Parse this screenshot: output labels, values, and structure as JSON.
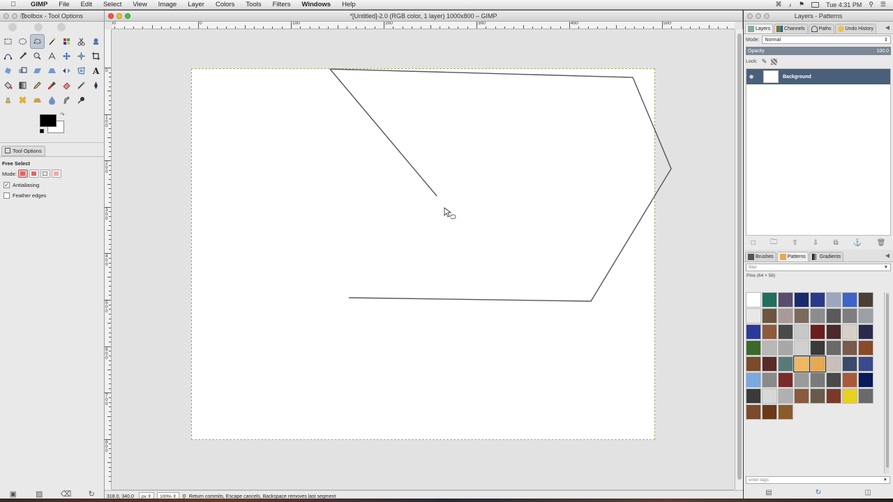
{
  "menubar": {
    "app_name": "GIMP",
    "items": [
      "File",
      "Edit",
      "Select",
      "View",
      "Image",
      "Layer",
      "Colors",
      "Tools",
      "Filters",
      "Windows",
      "Help"
    ],
    "clock": "Tue 4:31 PM"
  },
  "toolbox": {
    "title": "Toolbox - Tool Options",
    "tab_label": "Tool Options",
    "tool_name": "Free Select",
    "mode_label": "Mode:",
    "antialiasing_label": "Antialiasing",
    "feather_label": "Feather edges",
    "antialiasing_checked": true,
    "feather_checked": false,
    "fg_color": "#000000",
    "bg_color": "#ffffff"
  },
  "image_window": {
    "title": "*[Untitled]-2.0 (RGB color, 1 layer) 1000x800 – GIMP",
    "ruler_top_labels": [
      "-100",
      "0",
      "100",
      "200",
      "300",
      "400",
      "500",
      "600",
      "700",
      "800",
      "900",
      "1000",
      "1100"
    ],
    "ruler_left_labels": [
      "0",
      "100",
      "200",
      "300",
      "400",
      "500",
      "600",
      "700",
      "800"
    ],
    "status": {
      "coords": "318.0, 340.0",
      "unit": "px",
      "zoom": "100%",
      "message": "Return commits, Escape cancels, Backspace removes last segment"
    }
  },
  "layers_dock": {
    "title": "Layers - Patterns",
    "tabs": [
      "Layers",
      "Channels",
      "Paths",
      "Undo History"
    ],
    "mode_label": "Mode:",
    "mode_value": "Normal",
    "opacity_label": "Opacity",
    "opacity_value": "100.0",
    "lock_label": "Lock:",
    "layers": [
      {
        "name": "Background"
      }
    ]
  },
  "patterns_dock": {
    "tabs": [
      "Brushes",
      "Patterns",
      "Gradients"
    ],
    "filter_placeholder": "filter",
    "info": "Pine (64 × 58)",
    "tags_placeholder": "enter tags",
    "swatches": [
      "#ffffff",
      "#1f6f5a",
      "#5a4c6e",
      "#1a2a6e",
      "#2a3a8a",
      "#9aa7c0",
      "#3f63c8",
      "#4b4038",
      "#e8e8e8",
      "#6d5540",
      "#a89a94",
      "#7a6a5a",
      "#8d8d8d",
      "#5a5a5a",
      "#7e7e7e",
      "#9aa0a6",
      "#2b3a9a",
      "#8e5b3c",
      "#4a4a4a",
      "#c8c8c8",
      "#6a1e1e",
      "#4a2a2a",
      "#d8d0c8",
      "#2a2a4a",
      "#3a6a2a",
      "#b8b8b8",
      "#a8a8a8",
      "#d0d0d0",
      "#3a3a3a",
      "#6a6a6a",
      "#7a5a4a",
      "#8a4a2a",
      "#7a4a2a",
      "#5a2a2a",
      "#5a7a7a",
      "#f0b860",
      "#e8a850",
      "#c8c0b8",
      "#3a4a6a",
      "#3a4a8a",
      "#7aa8e0",
      "#8a8a8a",
      "#7a2a2a",
      "#9a9a9a",
      "#7a7a7a",
      "#4a4a4a",
      "#a85a3a",
      "#0a1a5a",
      "#3a3a3a",
      "#d8d8d8",
      "#b0b0b0",
      "#8a5a3a",
      "#6a5a4a",
      "#7a3a2a",
      "#e8d020",
      "#6a6a6a",
      "#7a4a2a",
      "#6a3a1a",
      "#8a5a2a"
    ]
  }
}
